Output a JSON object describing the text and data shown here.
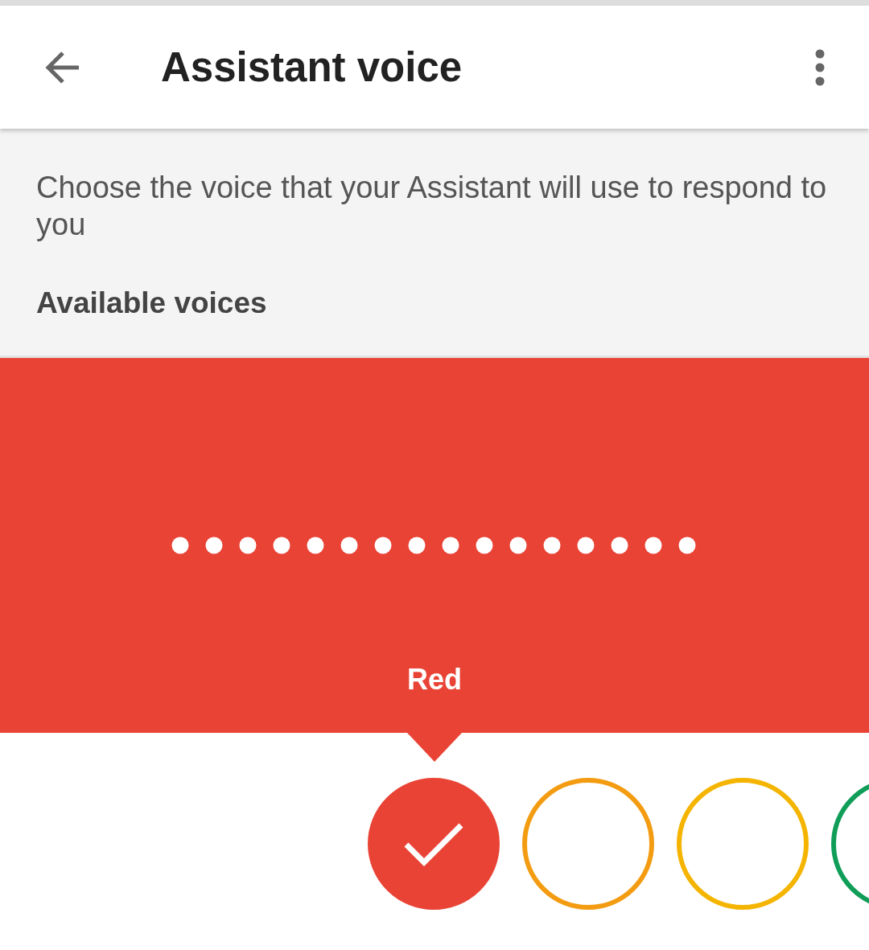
{
  "app_bar": {
    "title": "Assistant voice"
  },
  "description": "Choose the voice that your Assistant will use to respond to you",
  "section_title": "Available voices",
  "voice_panel": {
    "color": "#e94335",
    "voice_label": "Red"
  },
  "voices": [
    {
      "color": "#e94335",
      "selected": true
    },
    {
      "color": "#f39c12",
      "selected": false
    },
    {
      "color": "#f4b400",
      "selected": false
    },
    {
      "color": "#0f9d58",
      "selected": false
    }
  ]
}
